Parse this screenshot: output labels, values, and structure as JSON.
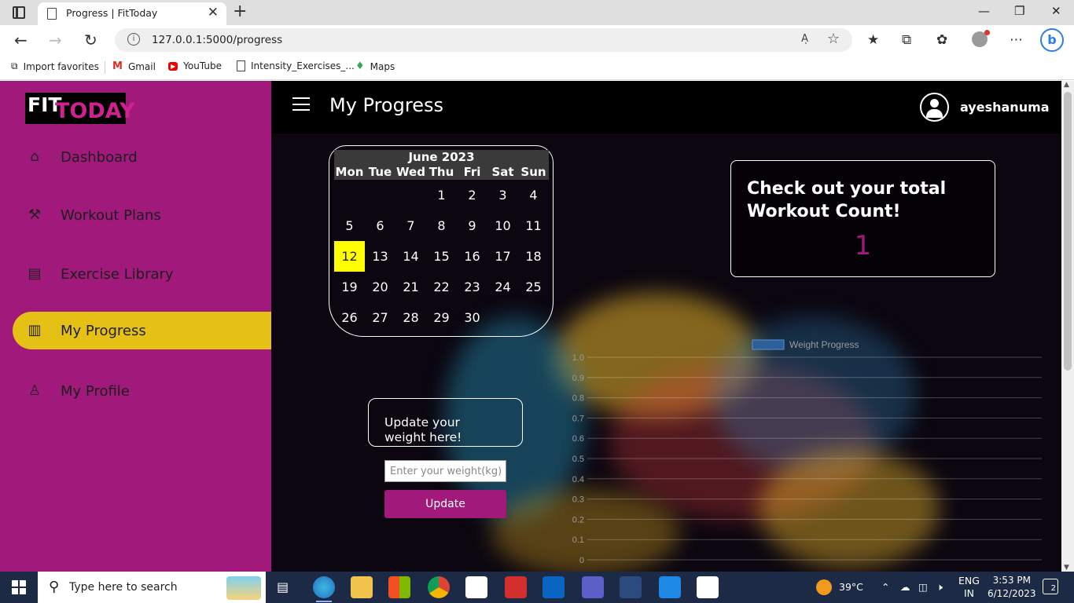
{
  "browser": {
    "tab_title": "Progress | FitToday",
    "tab_close": "✕",
    "new_tab": "+",
    "url": "127.0.0.1:5000/progress",
    "read_aloud": "Aͅ",
    "bookmarks": [
      {
        "label": "Import favorites",
        "icon": "import-icon"
      },
      {
        "label": "Gmail",
        "icon": "gmail-icon"
      },
      {
        "label": "YouTube",
        "icon": "youtube-icon"
      },
      {
        "label": "Intensity_Exercises_...",
        "icon": "page-icon"
      },
      {
        "label": "Maps",
        "icon": "maps-icon"
      }
    ]
  },
  "sidebar": {
    "logo_fit": "FIT",
    "logo_today": "TODAY",
    "items": [
      {
        "label": "Dashboard",
        "icon": "home-icon",
        "glyph": "⌂"
      },
      {
        "label": "Workout Plans",
        "icon": "dumbbell-icon",
        "glyph": "⚒"
      },
      {
        "label": "Exercise Library",
        "icon": "clipboard-icon",
        "glyph": "▤"
      },
      {
        "label": "My Progress",
        "icon": "bar-chart-icon",
        "glyph": "▥"
      },
      {
        "label": "My Profile",
        "icon": "user-icon",
        "glyph": "♙"
      }
    ],
    "active_index": 3
  },
  "header": {
    "title": "My Progress",
    "username": "ayeshanuma"
  },
  "calendar": {
    "month_label": "June 2023",
    "weekdays": [
      "Mon",
      "Tue",
      "Wed",
      "Thu",
      "Fri",
      "Sat",
      "Sun"
    ],
    "first_weekday_index": 3,
    "days_in_month": 30,
    "today": 12,
    "today_color": "#ffff00"
  },
  "workout_count": {
    "title": "Check out your total Workout Count!",
    "value": "1"
  },
  "weight_form": {
    "title": "Update your weight here!",
    "placeholder": "Enter your weight(kg)",
    "button_label": "Update"
  },
  "chart_data": {
    "type": "line",
    "series": [
      {
        "name": "Weight Progress",
        "values": []
      }
    ],
    "yticks": [
      "1.0",
      "0.9",
      "0.8",
      "0.7",
      "0.6",
      "0.5",
      "0.4",
      "0.3",
      "0.2",
      "0.1",
      "0"
    ],
    "ylim": [
      0,
      1
    ],
    "legend_color": "#2d5f9b",
    "legend_position": "top"
  },
  "taskbar": {
    "search_placeholder": "Type here to search",
    "weather": "39°C",
    "lang_top": "ENG",
    "lang_bottom": "IN",
    "time": "3:53 PM",
    "date": "6/12/2023",
    "notifications": "2"
  },
  "colors": {
    "brand_magenta": "#a0197b",
    "active_yellow": "#e5c116",
    "page_dark": "#0b0610"
  }
}
